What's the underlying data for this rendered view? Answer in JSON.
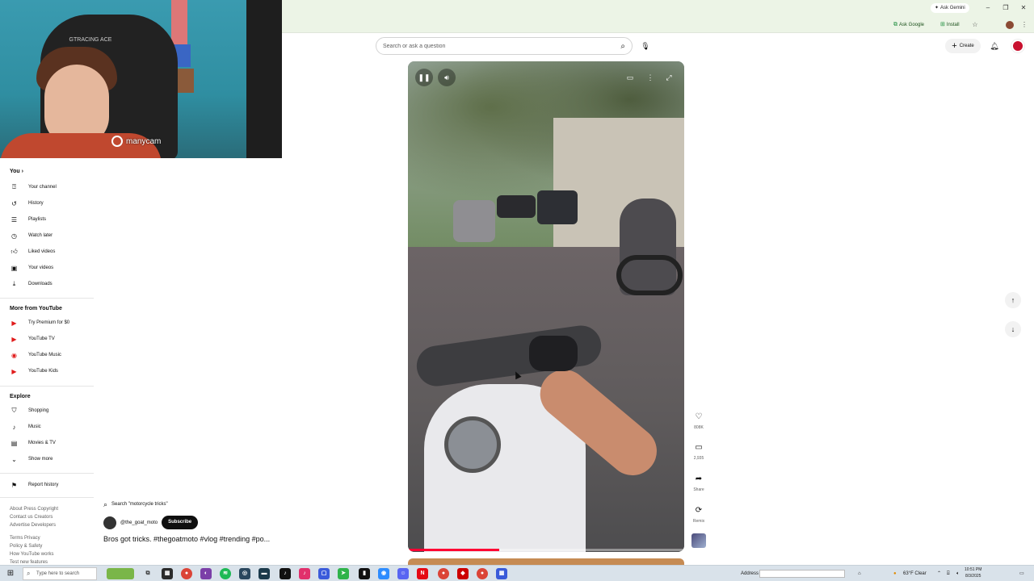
{
  "browser": {
    "gemini_label": "Ask Gemini",
    "ask_google_label": "Ask Google",
    "install_label": "Install",
    "minimize_glyph": "–",
    "restore_glyph": "❐",
    "close_glyph": "✕"
  },
  "webcam": {
    "brand_text": "manycam",
    "chair_text": "GTRACING ACE"
  },
  "header": {
    "search_placeholder": "Search or ask a question",
    "create_label": "Create"
  },
  "sidebar": {
    "you": {
      "title": "You",
      "items": [
        {
          "label": "Your channel",
          "icon": "person-icon"
        },
        {
          "label": "History",
          "icon": "history-icon"
        },
        {
          "label": "Playlists",
          "icon": "playlist-icon"
        },
        {
          "label": "Watch later",
          "icon": "clock-icon"
        },
        {
          "label": "Liked videos",
          "icon": "thumb-up-icon"
        },
        {
          "label": "Your videos",
          "icon": "video-icon"
        },
        {
          "label": "Downloads",
          "icon": "download-icon"
        }
      ]
    },
    "more": {
      "title": "More from YouTube",
      "items": [
        {
          "label": "Try Premium for $0",
          "icon": "youtube-premium-icon"
        },
        {
          "label": "YouTube TV",
          "icon": "youtube-tv-icon"
        },
        {
          "label": "YouTube Music",
          "icon": "youtube-music-icon"
        },
        {
          "label": "YouTube Kids",
          "icon": "youtube-kids-icon"
        }
      ]
    },
    "explore": {
      "title": "Explore",
      "items": [
        {
          "label": "Shopping",
          "icon": "shopping-bag-icon"
        },
        {
          "label": "Music",
          "icon": "music-note-icon"
        },
        {
          "label": "Movies & TV",
          "icon": "film-icon"
        },
        {
          "label": "Show more",
          "icon": "chevron-down-icon"
        }
      ]
    },
    "report": {
      "label": "Report history",
      "icon": "flag-icon"
    },
    "footer": {
      "line1": "About  Press  Copyright",
      "line2": "Contact us  Creators",
      "line3": "Advertise  Developers",
      "line4": "Terms  Privacy",
      "line5": "Policy & Safety",
      "line6": "How YouTube works",
      "line7": "Test new features"
    }
  },
  "short": {
    "search_suggestion": "Search \"motorcycle tricks\"",
    "channel": "@the_goat_moto",
    "subscribe_label": "Subscribe",
    "title": "Bros got tricks. #thegoatmoto #vlog #trending #po...",
    "progress": 0.33,
    "actions": {
      "like_count": "808K",
      "comment_count": "2,935",
      "share_label": "Share",
      "remix_label": "Remix"
    }
  },
  "taskbar": {
    "search_placeholder": "Type here to search",
    "address_label": "Address",
    "weather": "63°F  Clear",
    "time": "10:51 PM",
    "date": "8/3/2025"
  },
  "colors": {
    "chrome_bg": "#ecf4e6",
    "youtube_red": "#ff0033",
    "subscribe_bg": "#0f0f0f"
  }
}
